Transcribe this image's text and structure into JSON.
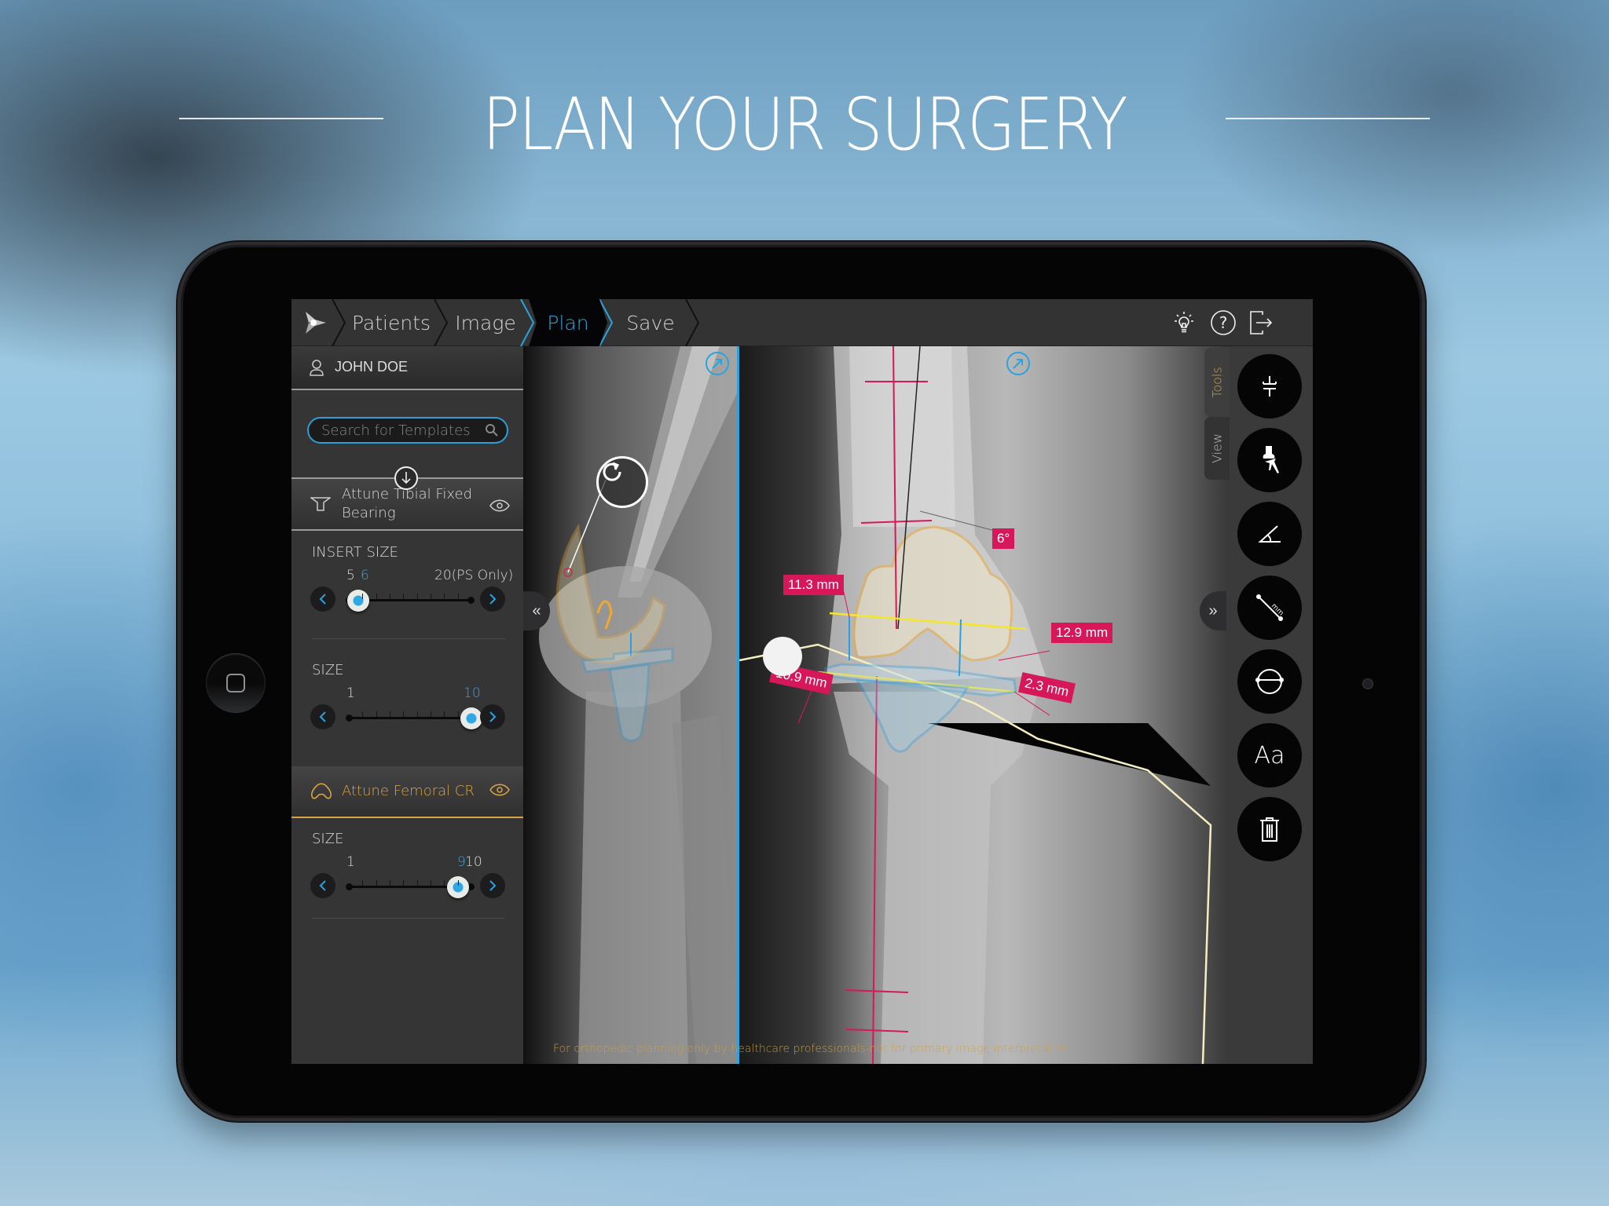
{
  "headline": "PLAN YOUR SURGERY",
  "nav": {
    "steps": [
      {
        "label": "Patients",
        "active": false
      },
      {
        "label": "Image",
        "active": false
      },
      {
        "label": "Plan",
        "active": true
      },
      {
        "label": "Save",
        "active": false
      }
    ],
    "icons": [
      "logo-icon",
      "lightbulb-icon",
      "help-icon",
      "exit-icon"
    ],
    "help_glyph": "?"
  },
  "patient": {
    "name": "JOHN DOE"
  },
  "search": {
    "placeholder": "Search for Templates"
  },
  "components": [
    {
      "name_line1": "Attune Tibial Fixed",
      "name_line2": "Bearing",
      "color": "#d8d8d8",
      "sliders": [
        {
          "label": "INSERT SIZE",
          "min_label": "5",
          "current": "6",
          "max_label": "20(PS Only)",
          "position_fraction": 0.08
        },
        {
          "label": "SIZE",
          "min_label": "1",
          "current": "10",
          "max_label": "",
          "position_fraction": 1.0
        }
      ]
    },
    {
      "name_line1": "Attune Femoral CR",
      "name_line2": "",
      "color": "#d9a441",
      "sliders": [
        {
          "label": "SIZE",
          "min_label": "1",
          "current": "9",
          "max_label": "10",
          "position_fraction": 0.89
        }
      ]
    }
  ],
  "measurements": {
    "angle": "6°",
    "femoral_medial": "11.3 mm",
    "femoral_lateral": "12.9 mm",
    "tibial_medial": "10.9 mm",
    "tibial_lateral": "2.3 mm"
  },
  "disclaimer": "For orthopedic planning only by healthcare professionals-not for primary image interpretation",
  "toolbar": {
    "tabs": [
      {
        "label": "Tools",
        "active": true
      },
      {
        "label": "View",
        "active": false
      }
    ],
    "tools": [
      "alignment-tool",
      "implant-tool",
      "angle-tool",
      "ruler-mm-tool",
      "circle-tool",
      "text-tool",
      "delete-tool"
    ],
    "text_tool_label": "Aa",
    "ruler_unit": "mm"
  },
  "colors": {
    "accent_blue": "#2ba3dc",
    "femoral_orange": "#f0a830",
    "tibial_blue": "#2aa0e0",
    "measure_pink": "#d6185b",
    "resection_yellow": "#f5e62a",
    "disclaimer_gold": "#c8a04d"
  }
}
